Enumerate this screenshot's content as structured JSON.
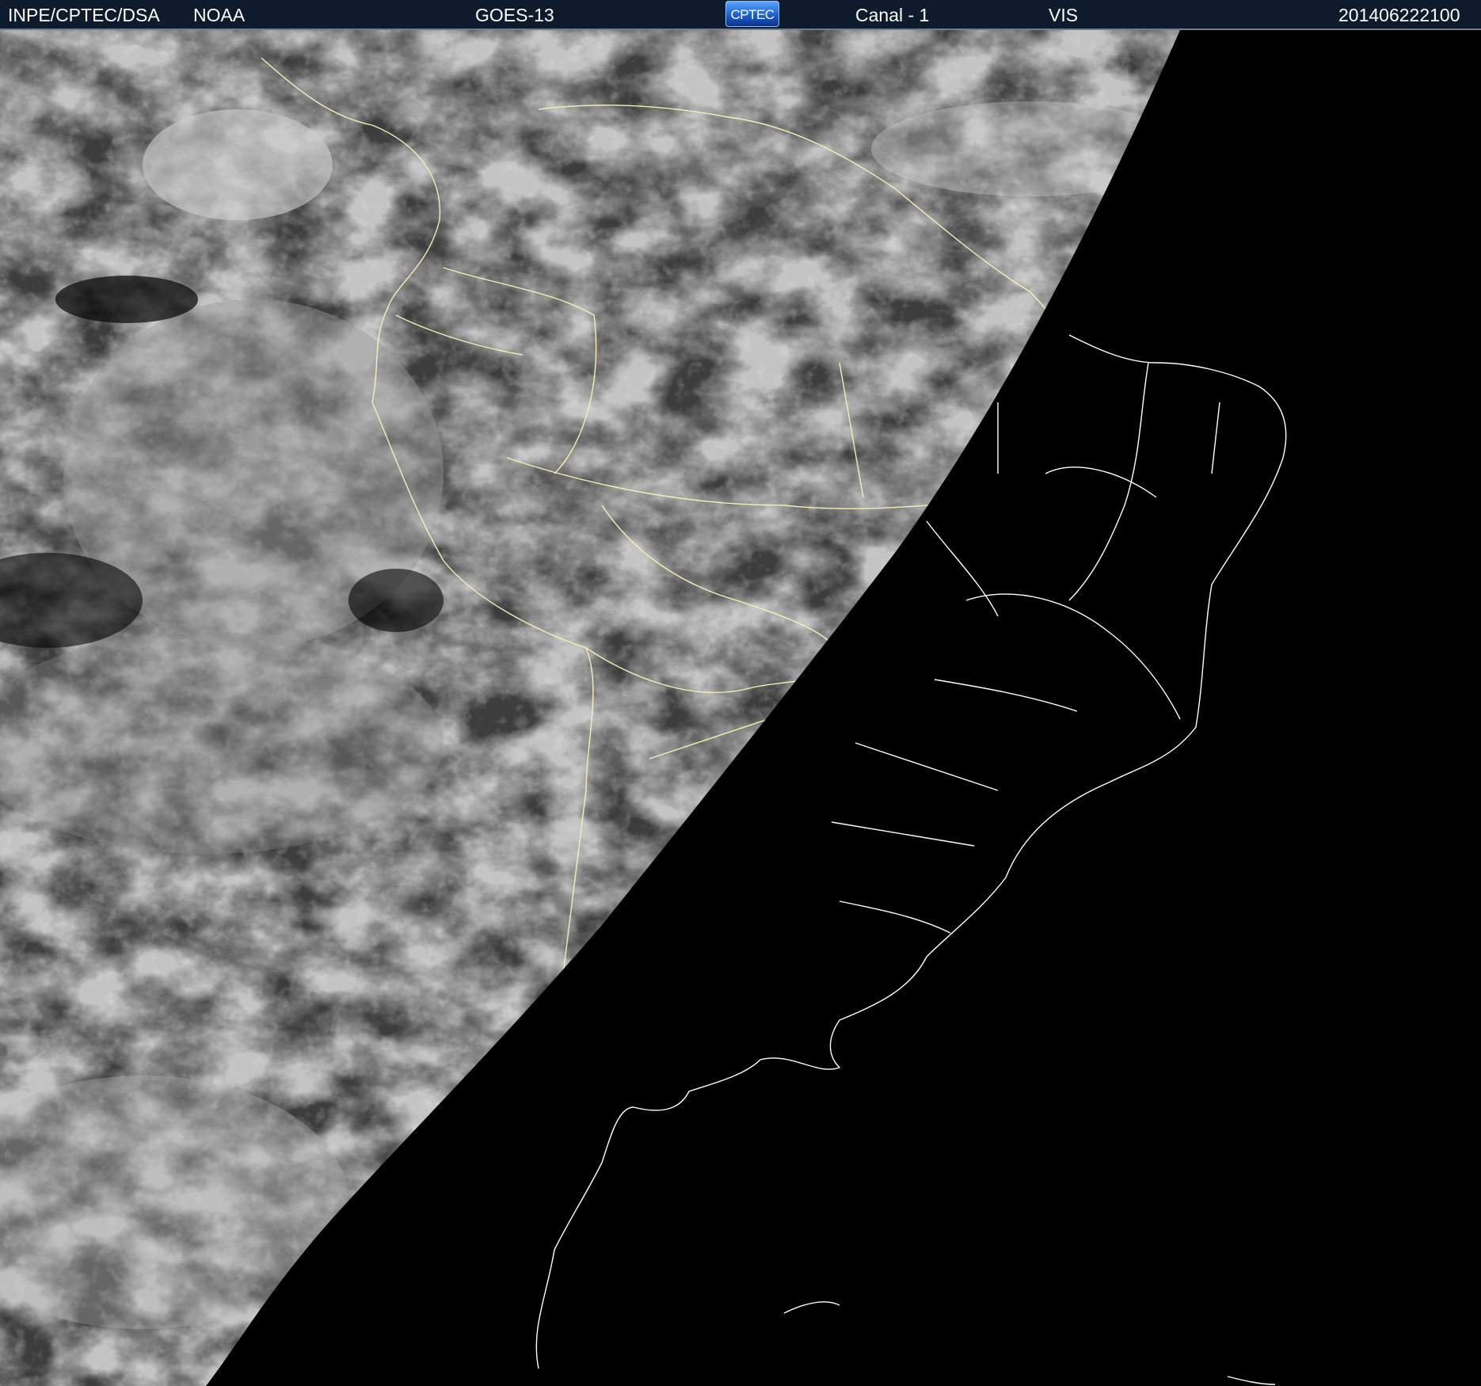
{
  "header": {
    "institution": "INPE/CPTEC/DSA",
    "agency": "NOAA",
    "satellite": "GOES-13",
    "logo_text": "CPTEC",
    "channel": "Canal - 1",
    "band": "VIS",
    "timestamp": "201406222100"
  },
  "colors": {
    "header_bg": "#0d1b2c",
    "header_text": "#ffffff",
    "day_border": "#f5f0b4",
    "night_border": "#ffffff",
    "night_bg": "#000000"
  },
  "map": {
    "region": "South America",
    "imagery": "visible satellite image, day/night terminator"
  }
}
